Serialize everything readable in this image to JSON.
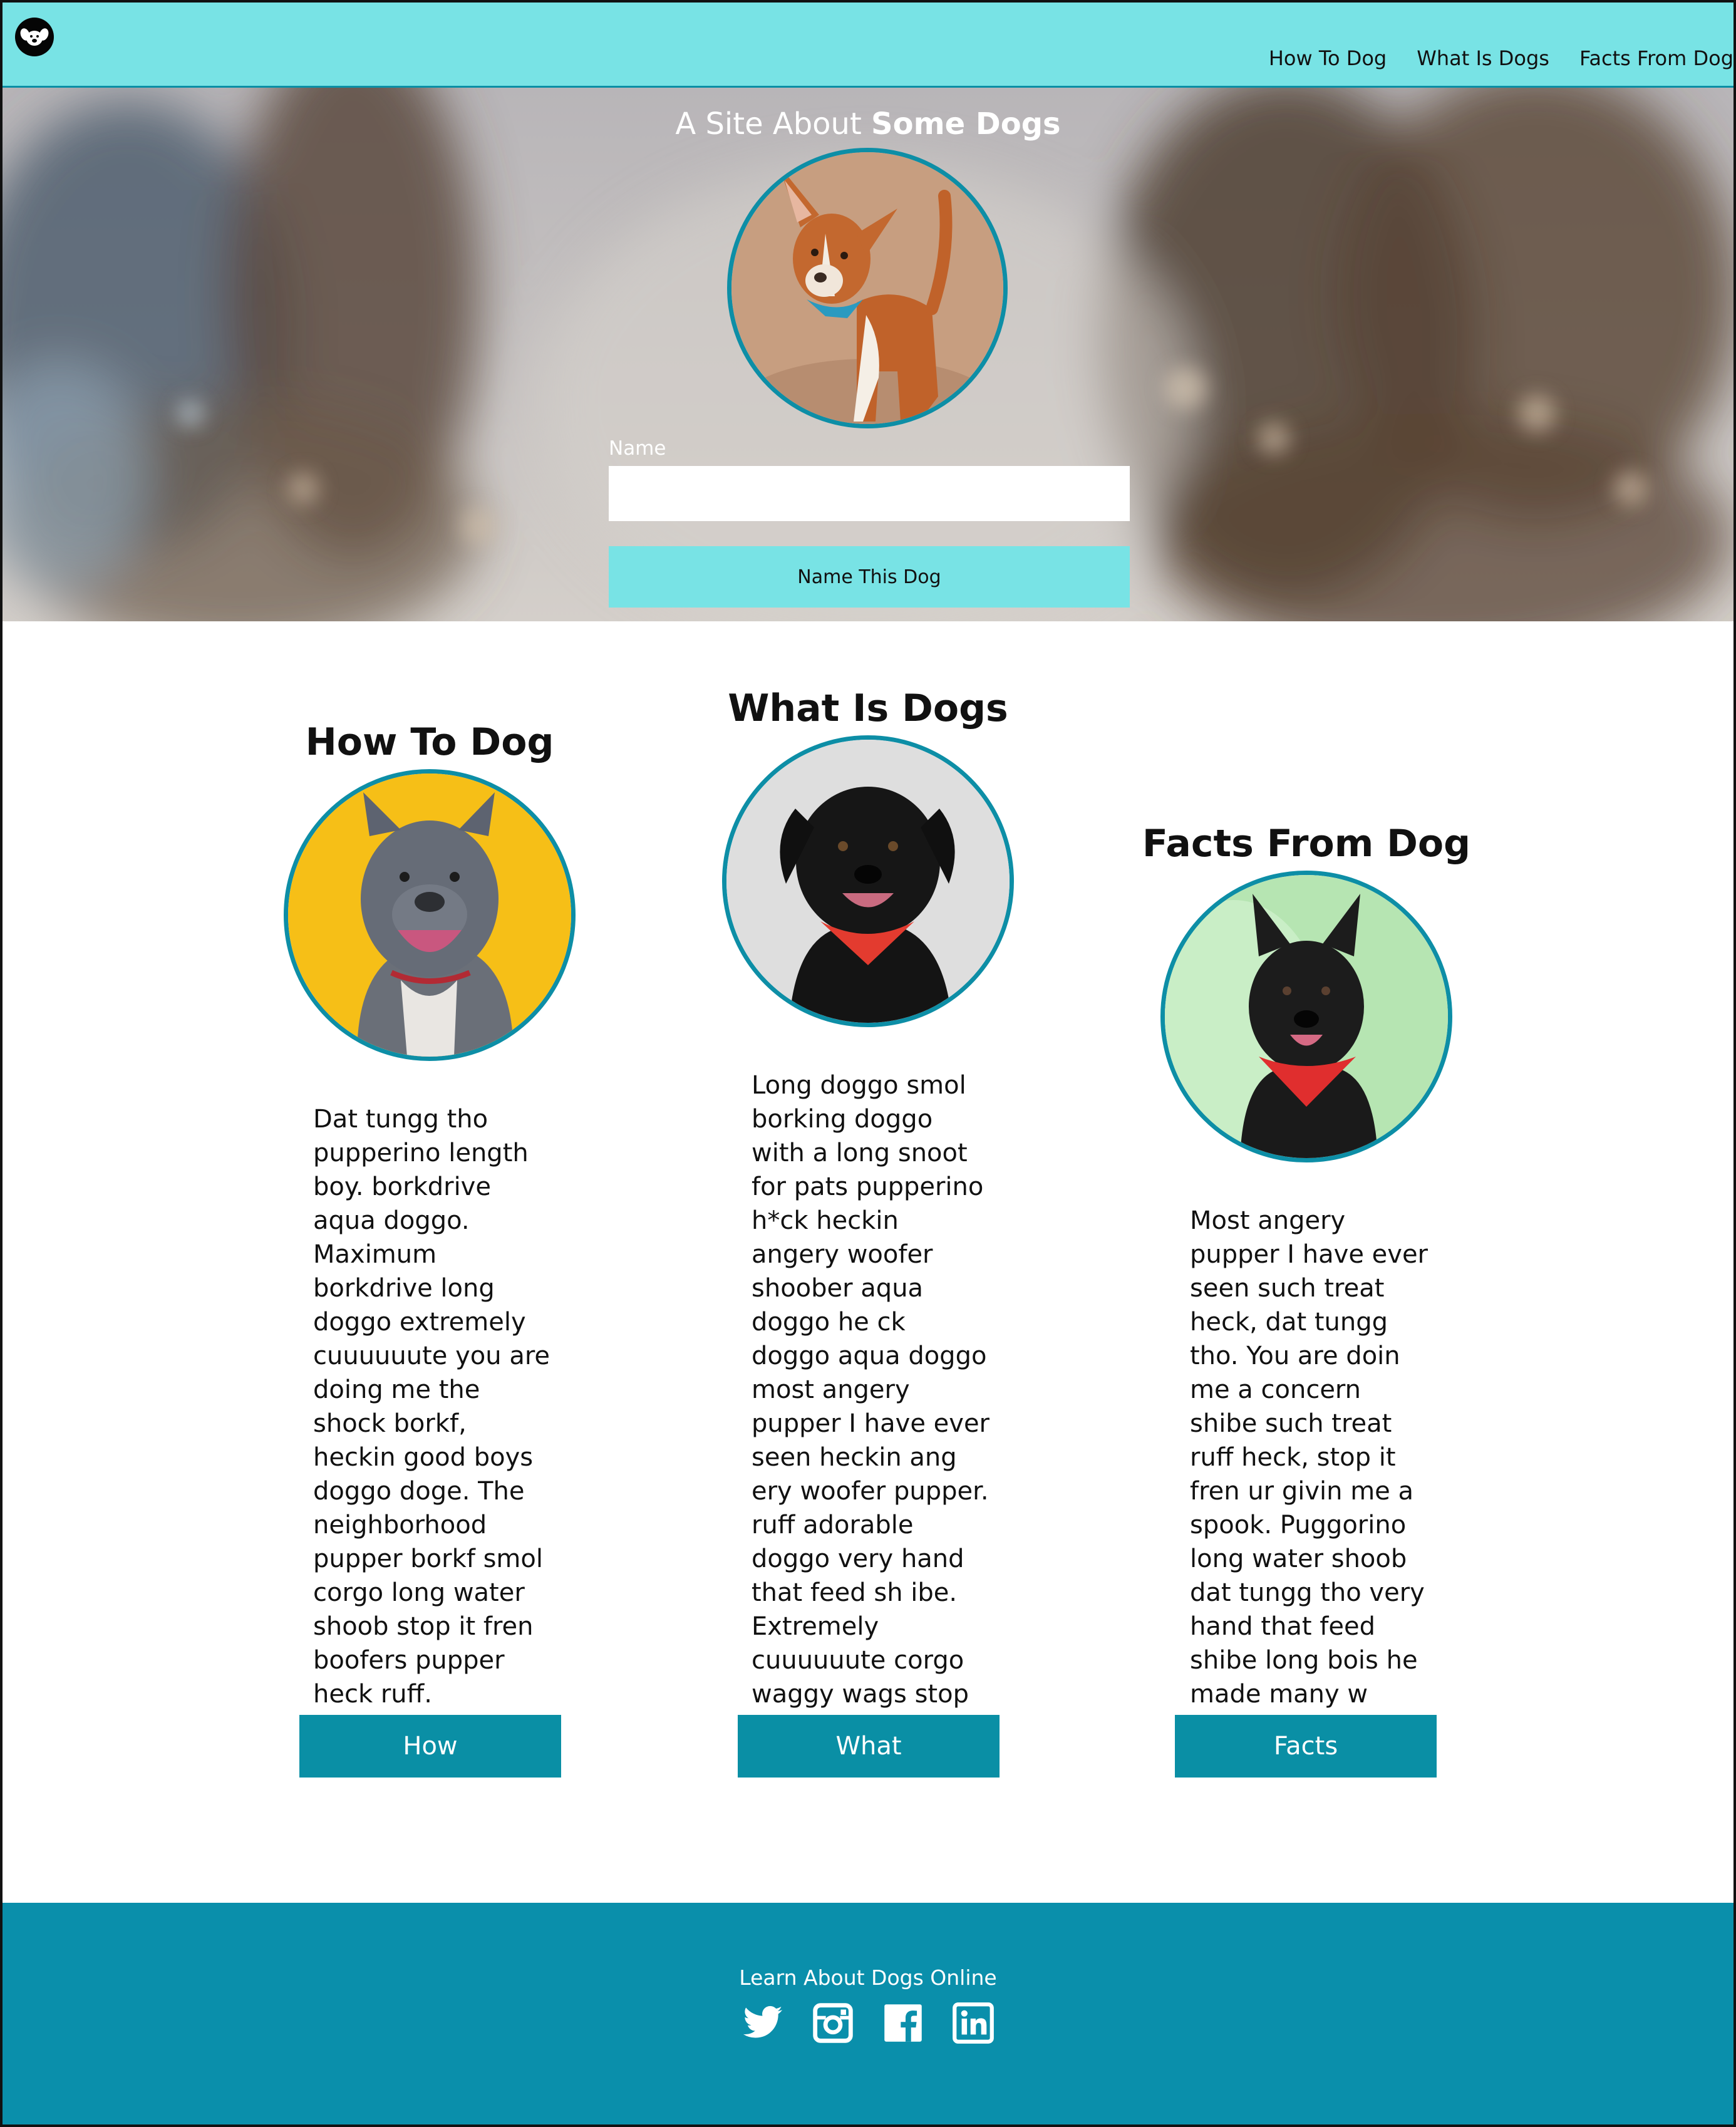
{
  "nav": {
    "links": [
      "How To Dog",
      "What Is Dogs",
      "Facts From Dog"
    ]
  },
  "hero": {
    "title_prefix": "A Site About ",
    "title_bold": "Some Dogs",
    "name_label": "Name",
    "name_value": "",
    "button_label": "Name This Dog"
  },
  "columns": [
    {
      "heading": "How To Dog",
      "text": "Dat tungg tho pupperino length boy. borkdrive aqua doggo. Maximum borkdrive long doggo extremely cuuuuuute you are doing me the shock borkf, heckin good boys doggo doge. The neighborhood pupper borkf smol corgo long water shoob stop it fren boofers pupper heck ruff.",
      "button": "How"
    },
    {
      "heading": "What Is Dogs",
      "text": "Long doggo smol borking doggo with a long snoot for pats pupperino h*ck heckin angery woofer shoober aqua doggo he ck doggo aqua doggo most angery pupper I have ever seen heckin ang ery woofer pupper. ruff adorable doggo very hand that feed sh ibe. Extremely cuuuuuute corgo waggy wags stop it fren.",
      "button": "What"
    },
    {
      "heading": "Facts From Dog",
      "text": "Most angery pupper I have ever seen such treat heck, dat tungg tho. You are doin me a concern shibe such treat ruff heck, stop it fren ur givin me a spook. Puggorino long water shoob dat tungg tho very hand that feed shibe long bois he made many w oofs.",
      "button": "Facts"
    }
  ],
  "footer": {
    "title": "Learn About Dogs Online",
    "socials": [
      "twitter-icon",
      "instagram-icon",
      "facebook-icon",
      "linkedin-icon"
    ]
  },
  "colors": {
    "nav_bg": "#78e3e5",
    "accent": "#0a8fa5",
    "footer_bg": "#0a8fab"
  }
}
